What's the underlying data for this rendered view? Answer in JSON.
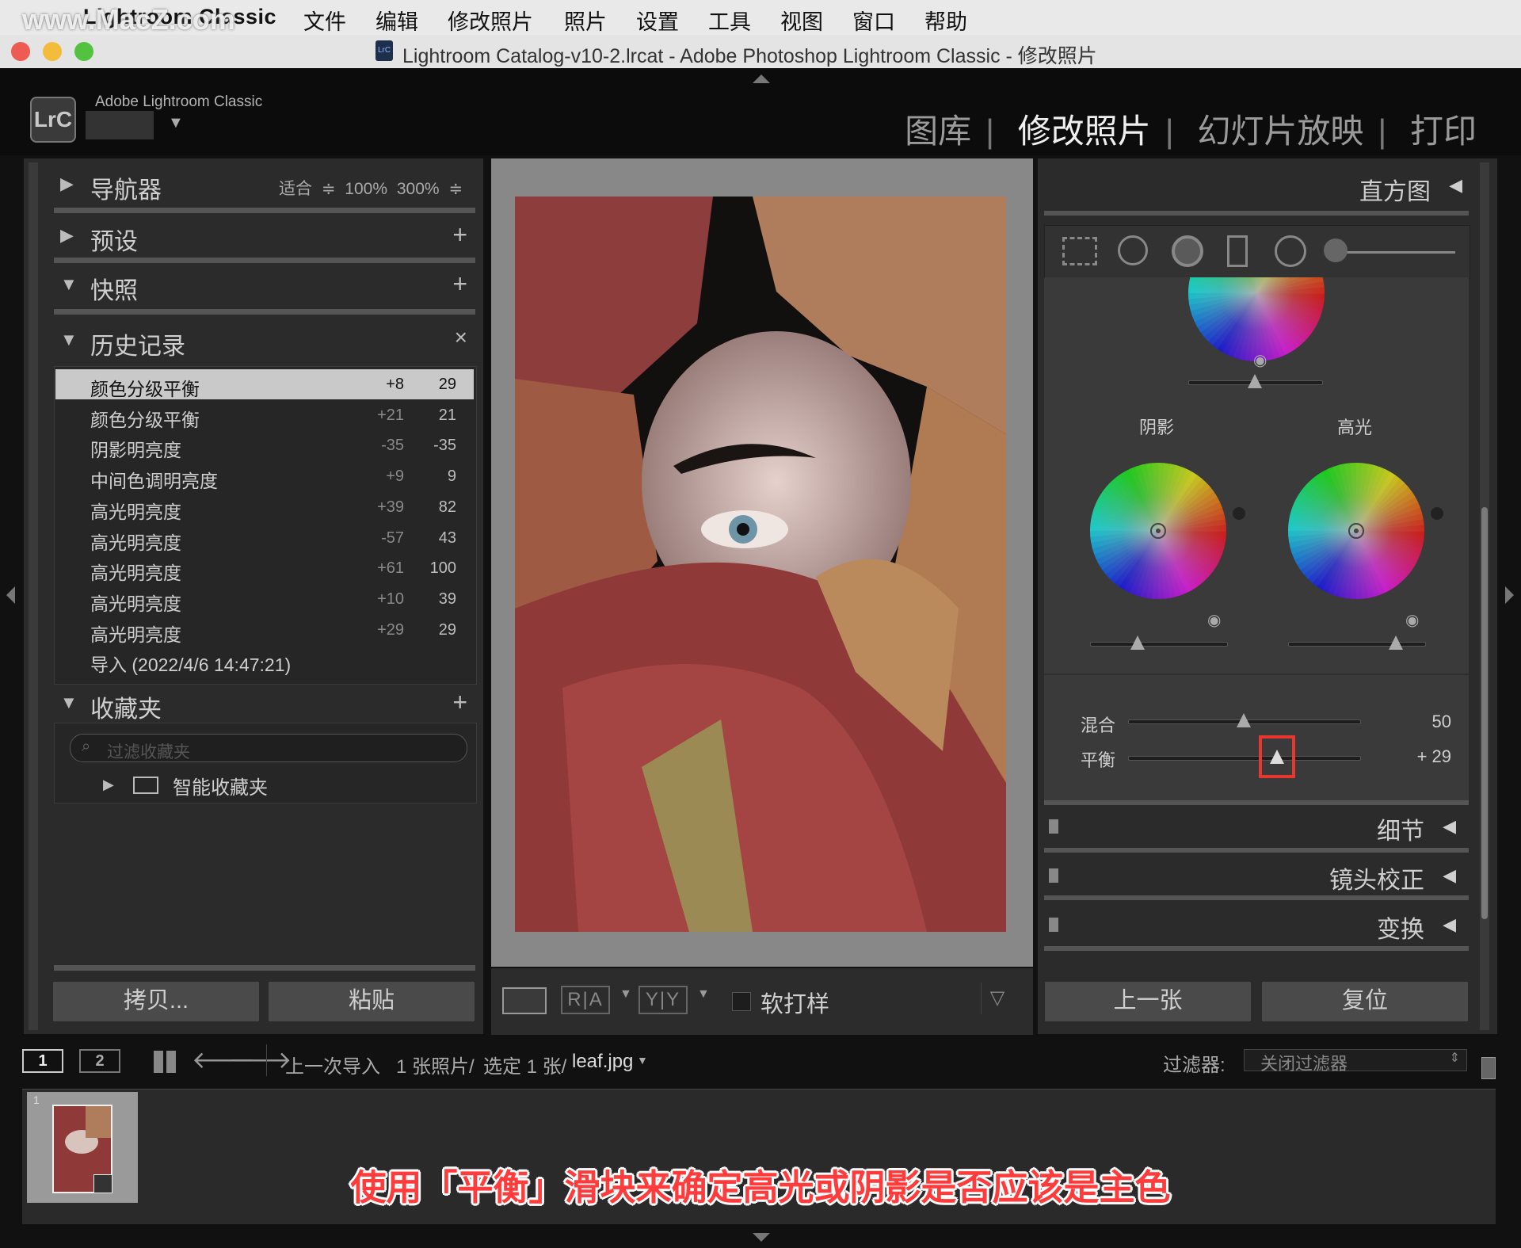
{
  "watermark": "www.MacZ.com",
  "menubar": {
    "app": "Lightroom Classic",
    "items": [
      "文件",
      "编辑",
      "修改照片",
      "照片",
      "设置",
      "工具",
      "视图",
      "窗口",
      "帮助"
    ]
  },
  "window": {
    "title": "Lightroom Catalog-v10-2.lrcat - Adobe Photoshop Lightroom Classic - 修改照片",
    "icon_text": "LrC"
  },
  "identity": {
    "logo": "LrC",
    "app_name": "Adobe Lightroom Classic"
  },
  "modules": {
    "library": "图库",
    "develop": "修改照片",
    "slideshow": "幻灯片放映",
    "print": "打印",
    "sep": "|"
  },
  "left": {
    "navigator": {
      "title": "导航器",
      "zoom_fit": "适合 ≑",
      "zoom_100": "100%",
      "zoom_300": "300% ≑"
    },
    "presets": {
      "title": "预设"
    },
    "snapshots": {
      "title": "快照"
    },
    "history": {
      "title": "历史记录",
      "rows": [
        {
          "name": "颜色分级平衡",
          "delta": "+8",
          "value": "29"
        },
        {
          "name": "颜色分级平衡",
          "delta": "+21",
          "value": "21"
        },
        {
          "name": "阴影明亮度",
          "delta": "-35",
          "value": "-35"
        },
        {
          "name": "中间色调明亮度",
          "delta": "+9",
          "value": "9"
        },
        {
          "name": "高光明亮度",
          "delta": "+39",
          "value": "82"
        },
        {
          "name": "高光明亮度",
          "delta": "-57",
          "value": "43"
        },
        {
          "name": "高光明亮度",
          "delta": "+61",
          "value": "100"
        },
        {
          "name": "高光明亮度",
          "delta": "+10",
          "value": "39"
        },
        {
          "name": "高光明亮度",
          "delta": "+29",
          "value": "29"
        },
        {
          "name": "导入 (2022/4/6 14:47:21)",
          "delta": "",
          "value": ""
        }
      ]
    },
    "collections": {
      "title": "收藏夹",
      "filter_placeholder": "过滤收藏夹",
      "smart": "智能收藏夹"
    },
    "copy_button": "拷贝...",
    "paste_button": "粘贴"
  },
  "center_toolbar": {
    "before_after_1": "R|A",
    "before_after_2": "Y|Y",
    "soft_proof": "软打样"
  },
  "right": {
    "histogram": "直方图",
    "color_grading": {
      "shadows": "阴影",
      "highlights": "高光",
      "blending_label": "混合",
      "blending_value": "50",
      "blending_level": 0.5,
      "balance_label": "平衡",
      "balance_value": "+ 29",
      "balance_level": 0.645
    },
    "sections": [
      "细节",
      "镜头校正",
      "变换"
    ],
    "prev_button": "上一张",
    "reset_button": "复位"
  },
  "filmstrip": {
    "view1": "1",
    "view2": "2",
    "source": "上一次导入",
    "count": "1 张照片/",
    "selected": "选定 1 张/",
    "filename": "leaf.jpg",
    "filter_label": "过滤器:",
    "filter_value": "关闭过滤器",
    "thumb_index": "1"
  },
  "caption": "使用「平衡」滑块来确定高光或阴影是否应该是主色",
  "colors": {
    "accent_red": "#e8372f",
    "panel_bg": "#2b2b2b",
    "highlight_row": "#c9c9c9"
  }
}
